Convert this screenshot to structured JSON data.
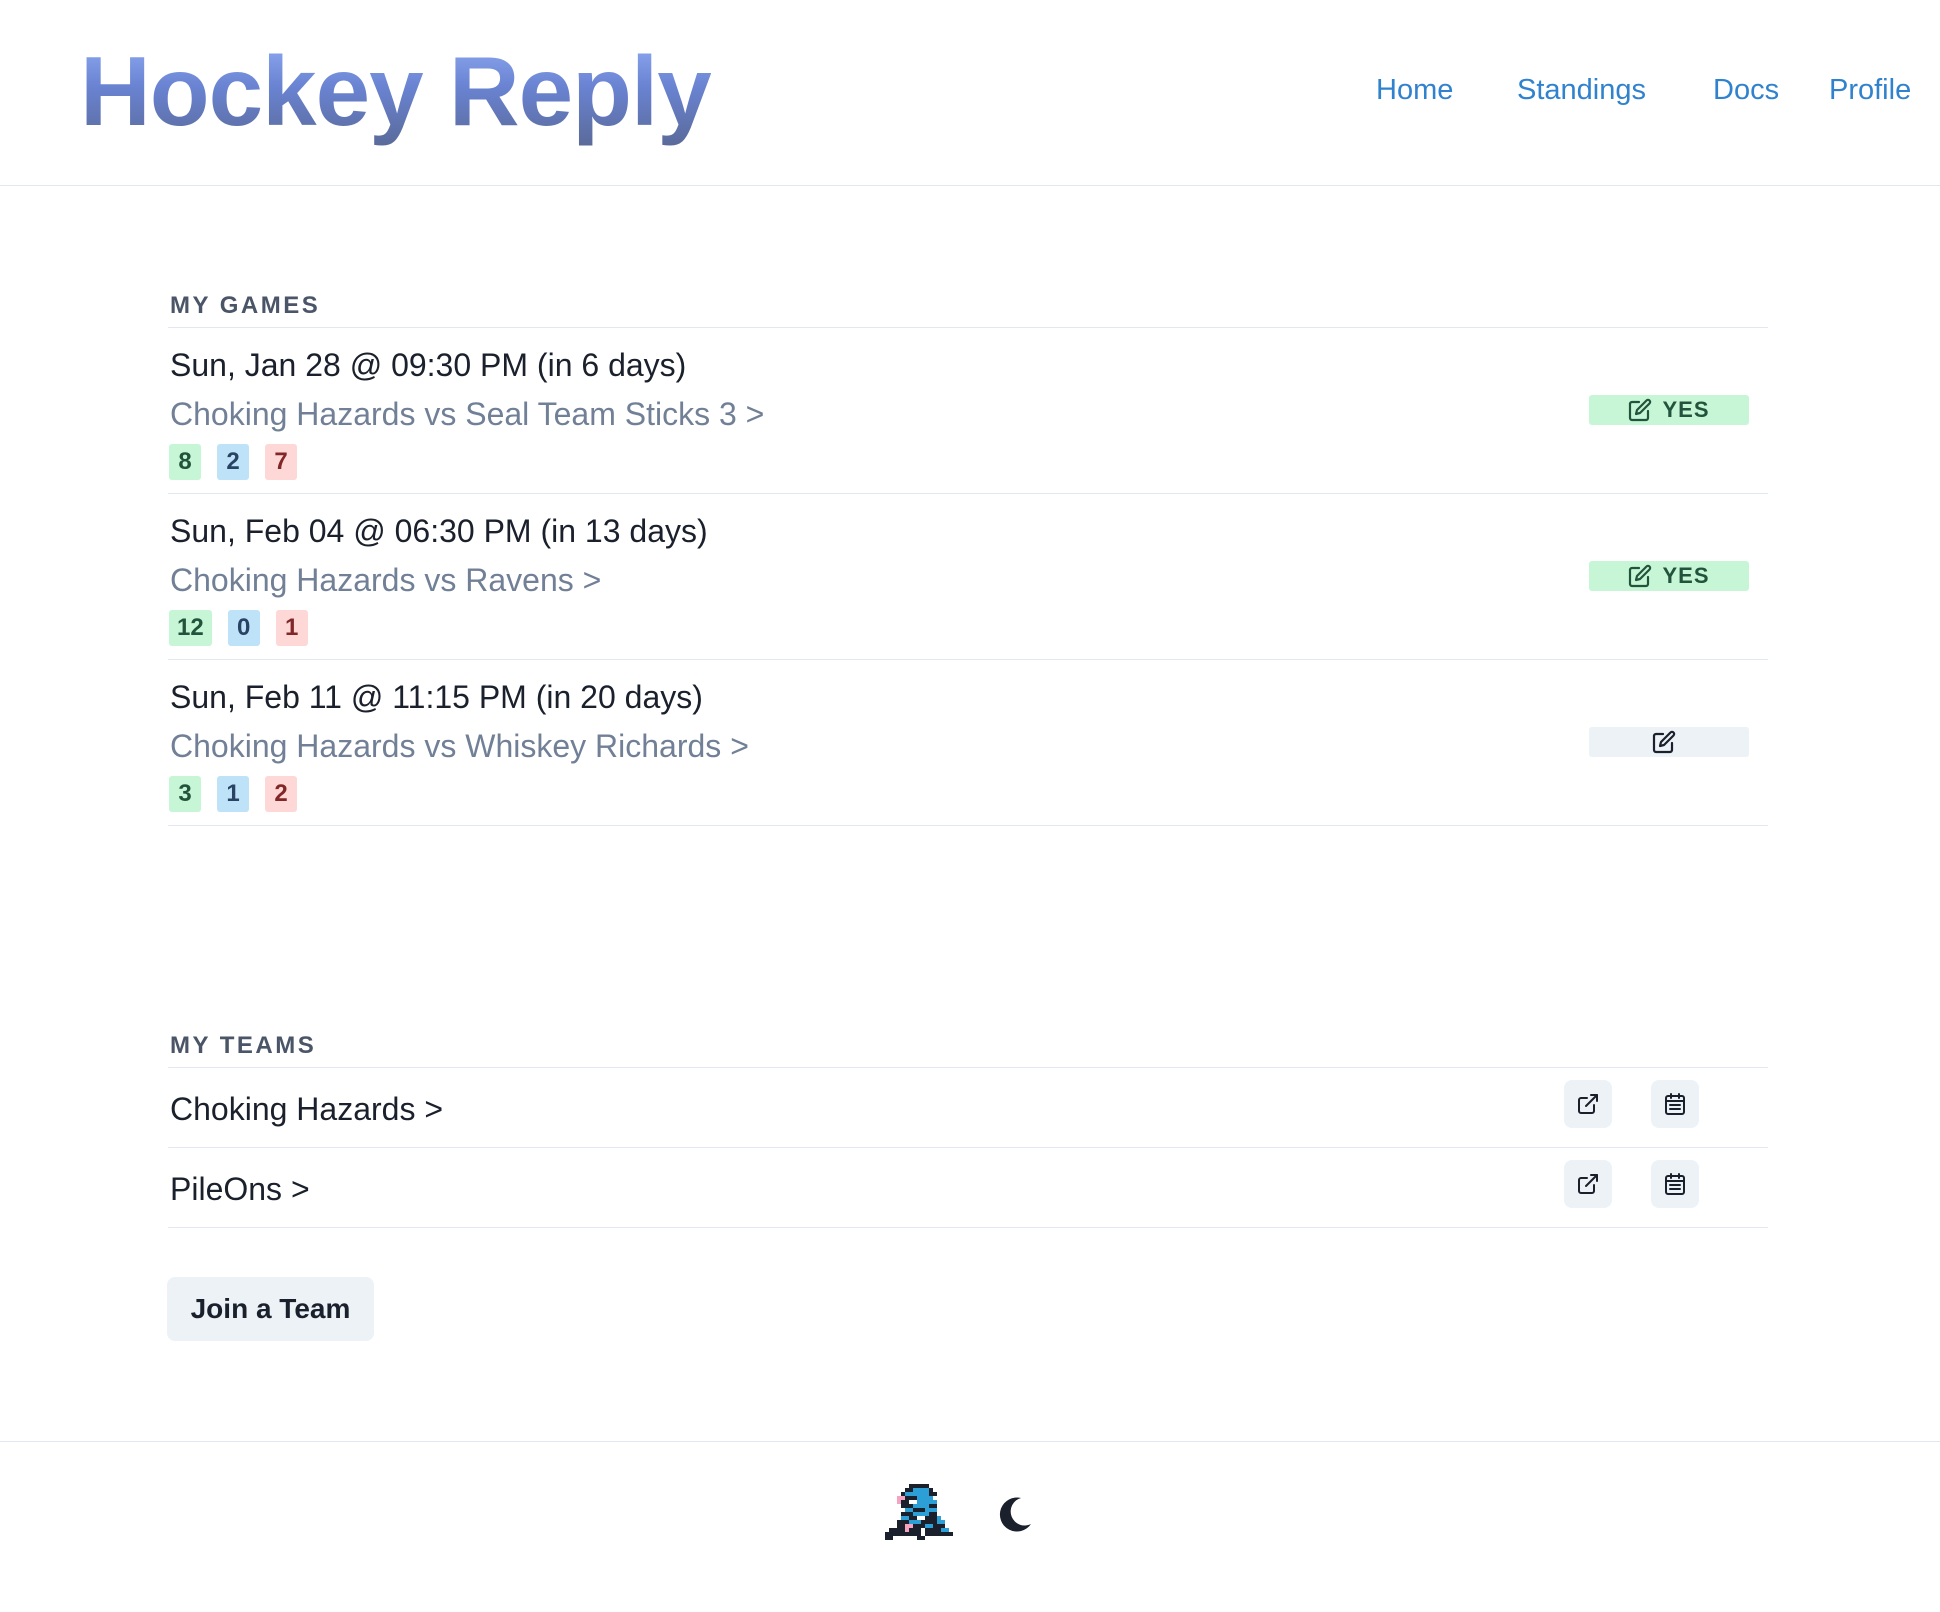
{
  "header": {
    "logo": "Hockey Reply",
    "nav": [
      "Home",
      "Standings",
      "Docs",
      "Profile"
    ]
  },
  "my_games": {
    "title": "MY GAMES",
    "games": [
      {
        "date": "Sun, Jan 28 @ 09:30 PM (in 6 days)",
        "matchup": "Choking Hazards vs Seal Team Sticks 3 >",
        "yes": "8",
        "maybe": "2",
        "no": "7",
        "rsvp": "YES"
      },
      {
        "date": "Sun, Feb 04 @ 06:30 PM (in 13 days)",
        "matchup": "Choking Hazards vs Ravens >",
        "yes": "12",
        "maybe": "0",
        "no": "1",
        "rsvp": "YES"
      },
      {
        "date": "Sun, Feb 11 @ 11:15 PM (in 20 days)",
        "matchup": "Choking Hazards vs Whiskey Richards >",
        "yes": "3",
        "maybe": "1",
        "no": "2",
        "rsvp": ""
      }
    ]
  },
  "my_teams": {
    "title": "MY TEAMS",
    "teams": [
      "Choking Hazards >",
      "PileOns >"
    ],
    "join_label": "Join a Team"
  },
  "colors": {
    "accent": "#3182ce",
    "yes_bg": "#c6f6d5",
    "maybe_bg": "#bee3f8",
    "no_bg": "#fed7d7"
  },
  "icons": [
    "edit-icon",
    "external-link-icon",
    "calendar-icon",
    "moon-icon",
    "mascot-icon"
  ]
}
